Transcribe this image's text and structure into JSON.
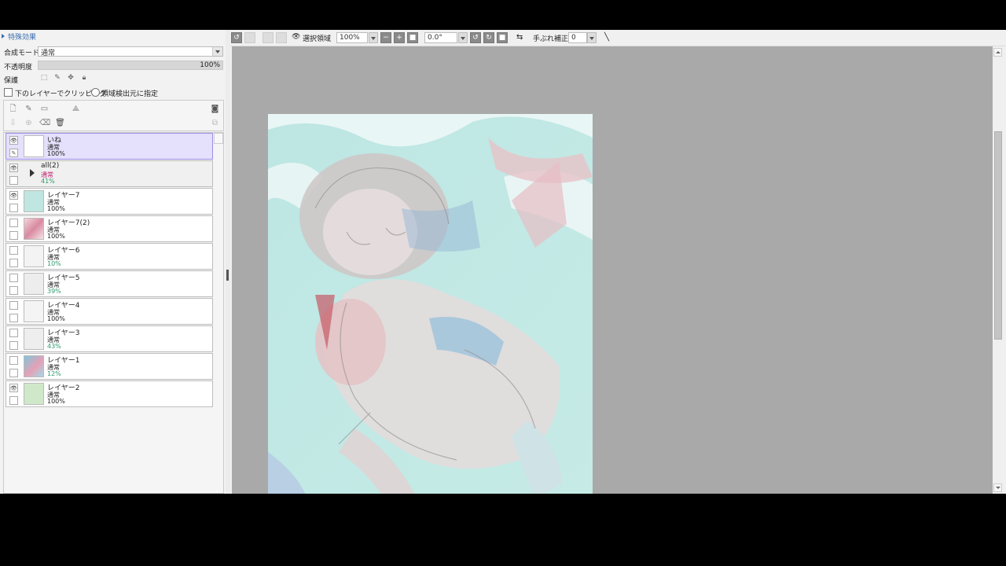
{
  "effects_panel": {
    "title": "特殊効果"
  },
  "layer_props": {
    "blend_label": "合成モード",
    "blend_value": "通常",
    "opacity_label": "不透明度",
    "opacity_value": "100%",
    "protect_label": "保護",
    "clip_label": "下のレイヤーでクリッピング",
    "source_label": "領域検出元に指定"
  },
  "layers": [
    {
      "name": "いね",
      "mode": "通常",
      "opacity": "100%",
      "visible": true,
      "selected": true,
      "thumb": "#ffffff"
    },
    {
      "name": "all(2)",
      "mode": "通常",
      "opacity": "41%",
      "visible": true,
      "folder": true
    },
    {
      "name": "レイヤー7",
      "mode": "通常",
      "opacity": "100%",
      "visible": true,
      "thumb": "#bfe6e0"
    },
    {
      "name": "レイヤー7(2)",
      "mode": "通常",
      "opacity": "100%",
      "visible": false,
      "thumb": "#e9b8c2"
    },
    {
      "name": "レイヤー6",
      "mode": "通常",
      "opacity": "10%",
      "visible": false,
      "thumb": "#f3f3f3"
    },
    {
      "name": "レイヤー5",
      "mode": "通常",
      "opacity": "39%",
      "visible": false,
      "thumb": "#ededed"
    },
    {
      "name": "レイヤー4",
      "mode": "通常",
      "opacity": "100%",
      "visible": false,
      "thumb": "#f4f4f4"
    },
    {
      "name": "レイヤー3",
      "mode": "通常",
      "opacity": "43%",
      "visible": false,
      "thumb": "#eeeeee"
    },
    {
      "name": "レイヤー1",
      "mode": "通常",
      "opacity": "12%",
      "visible": false,
      "thumb": "#8fd0de"
    },
    {
      "name": "レイヤー2",
      "mode": "通常",
      "opacity": "100%",
      "visible": true,
      "thumb": "#cfe8c9"
    }
  ],
  "toolbar": {
    "selection_label": "選択領域",
    "zoom_value": "100%",
    "angle_value": "0.0°",
    "stabilizer_label": "手ぶれ補正",
    "stabilizer_value": "0"
  },
  "colors": {
    "canvas_bg": "#a9a9a9",
    "selected_layer": "#e5e0fb",
    "opacity_partial": "#2e9a6b"
  }
}
